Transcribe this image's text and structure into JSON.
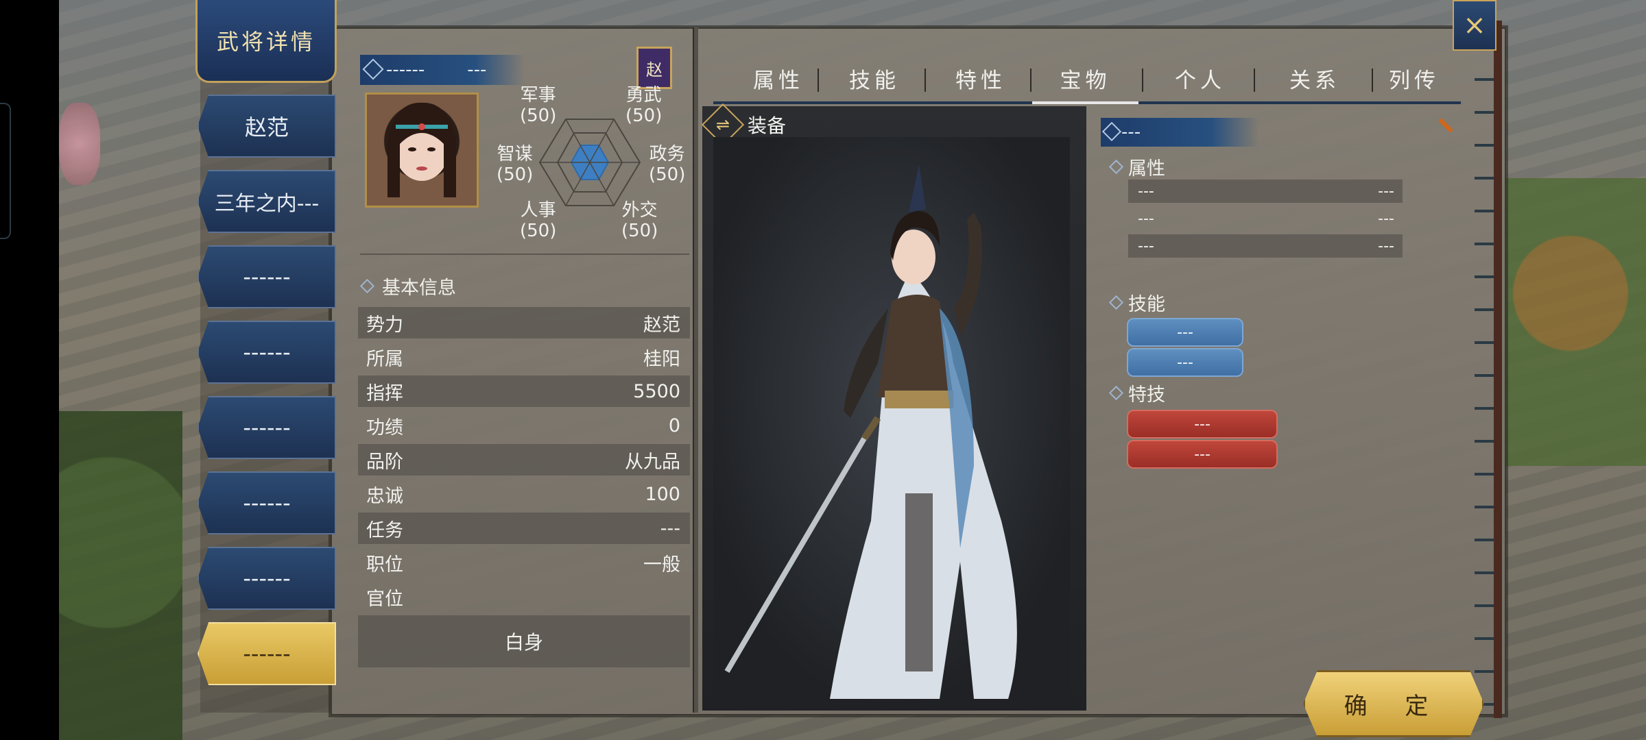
{
  "header": {
    "title": "武将详情",
    "close_icon": "×"
  },
  "sidebar": {
    "items": [
      {
        "label": "赵范",
        "active": false
      },
      {
        "label": "三年之内---",
        "active": false
      },
      {
        "label": "------",
        "active": false
      },
      {
        "label": "------",
        "active": false
      },
      {
        "label": "------",
        "active": false
      },
      {
        "label": "------",
        "active": false
      },
      {
        "label": "------",
        "active": false
      },
      {
        "label": "------",
        "active": true
      }
    ]
  },
  "profile": {
    "name_part1": "------",
    "name_part2": "---",
    "clan_char": "赵",
    "stats": {
      "military": {
        "label": "军事",
        "value": "(50)"
      },
      "valor": {
        "label": "勇武",
        "value": "(50)"
      },
      "intellect": {
        "label": "智谋",
        "value": "(50)"
      },
      "politics": {
        "label": "政务",
        "value": "(50)"
      },
      "personnel": {
        "label": "人事",
        "value": "(50)"
      },
      "diplomacy": {
        "label": "外交",
        "value": "(50)"
      }
    }
  },
  "basic_info": {
    "title": "基本信息",
    "rows": [
      {
        "label": "势力",
        "value": "赵范"
      },
      {
        "label": "所属",
        "value": "桂阳"
      },
      {
        "label": "指挥",
        "value": "5500"
      },
      {
        "label": "功绩",
        "value": "0"
      },
      {
        "label": "品阶",
        "value": "从九品"
      },
      {
        "label": "忠诚",
        "value": "100"
      },
      {
        "label": "任务",
        "value": "---"
      },
      {
        "label": "职位",
        "value": "一般"
      },
      {
        "label": "官位",
        "value": ""
      }
    ],
    "rank_value": "白身"
  },
  "tabs": [
    {
      "label": "属性",
      "active": false
    },
    {
      "label": "技能",
      "active": false
    },
    {
      "label": "特性",
      "active": false
    },
    {
      "label": "宝物",
      "active": true
    },
    {
      "label": "个人",
      "active": false
    },
    {
      "label": "关系",
      "active": false
    },
    {
      "label": "列传",
      "active": false
    }
  ],
  "equipment": {
    "title": "装备",
    "icon": "⇌",
    "item_name": "---",
    "attributes_title": "属性",
    "attributes": [
      {
        "left": "---",
        "right": "---"
      },
      {
        "left": "---",
        "right": "---"
      },
      {
        "left": "---",
        "right": "---"
      }
    ],
    "skills_title": "技能",
    "skills": [
      "---",
      "---"
    ],
    "specials_title": "特技",
    "specials": [
      "---",
      "---"
    ]
  },
  "footer": {
    "confirm_label": "确 定"
  },
  "colors": {
    "accent_gold": "#c9a45a",
    "panel_blue": "#1d3152",
    "skill_blue": "#4f80b4",
    "special_red": "#b03c33"
  }
}
